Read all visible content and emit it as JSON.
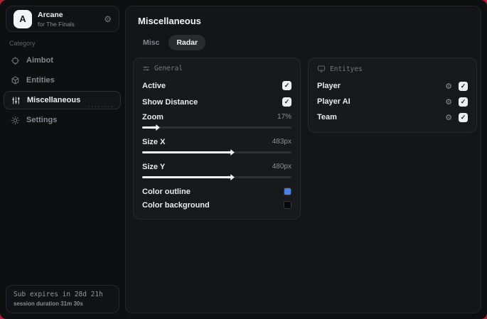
{
  "colors": {
    "backdrop": "#b51f3f",
    "window_bg": "#0e0f11",
    "panel_bg": "#141519",
    "accent_blue": "#4d80e6"
  },
  "sidebar": {
    "header": {
      "logo_letter": "A",
      "title": "Arcane",
      "subtitle": "for The Finals"
    },
    "category_label": "Category",
    "items": [
      {
        "label": "Aimbot",
        "active": false
      },
      {
        "label": "Entities",
        "active": false
      },
      {
        "label": "Miscellaneous",
        "active": true
      },
      {
        "label": "Settings",
        "active": false
      }
    ],
    "dots": "········",
    "footer": {
      "sub_expires": "Sub expires in 28d 21h",
      "session_duration": "session duration 31m 30s"
    }
  },
  "main": {
    "title": "Miscellaneous",
    "tabs": [
      {
        "label": "Misc",
        "active": false
      },
      {
        "label": "Radar",
        "active": true
      }
    ],
    "general": {
      "title": "General",
      "active": {
        "label": "Active",
        "checked": true
      },
      "show_distance": {
        "label": "Show Distance",
        "checked": true
      },
      "zoom": {
        "label": "Zoom",
        "value": "17%",
        "percent": 8
      },
      "size_x": {
        "label": "Size X",
        "value": "483px",
        "percent": 58
      },
      "size_y": {
        "label": "Size Y",
        "value": "480px",
        "percent": 58
      },
      "color_outline": {
        "label": "Color outline",
        "color": "#4d80e6"
      },
      "color_background": {
        "label": "Color background",
        "color": "#06070a"
      }
    },
    "entities": {
      "title": "Entityes",
      "rows": [
        {
          "label": "Player",
          "checked": true
        },
        {
          "label": "Player AI",
          "checked": true
        },
        {
          "label": "Team",
          "checked": true
        }
      ]
    }
  }
}
